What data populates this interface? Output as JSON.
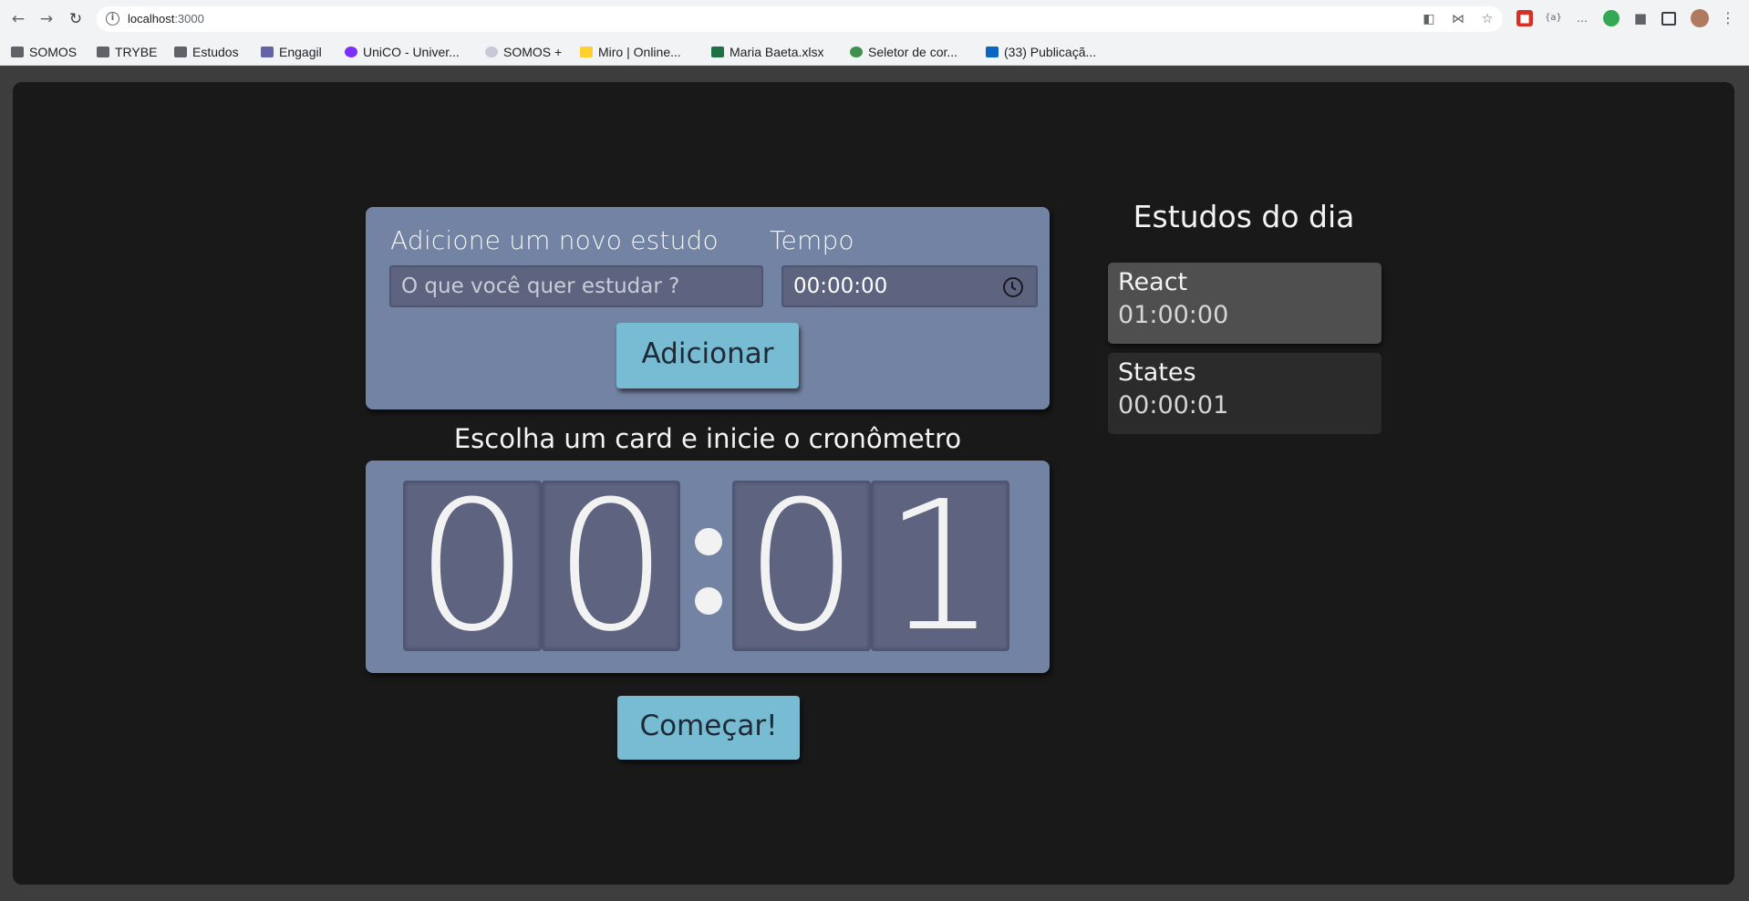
{
  "browser": {
    "url_host": "localhost",
    "url_port": ":3000",
    "bookmarks": [
      {
        "label": "SOMOS",
        "icon": "folder-icon"
      },
      {
        "label": "TRYBE",
        "icon": "folder-icon"
      },
      {
        "label": "Estudos",
        "icon": "folder-icon"
      },
      {
        "label": "Engagil",
        "icon": "teams-icon"
      },
      {
        "label": "UniCO - Univer...",
        "icon": "unico-icon"
      },
      {
        "label": "SOMOS +",
        "icon": "somos-plus-icon"
      },
      {
        "label": "Miro | Online...",
        "icon": "miro-icon"
      },
      {
        "label": "Maria Baeta.xlsx",
        "icon": "excel-icon"
      },
      {
        "label": "Seletor de cor...",
        "icon": "color-picker-icon"
      },
      {
        "label": "(33) Publicaçã...",
        "icon": "linkedin-icon"
      }
    ]
  },
  "form": {
    "study_label": "Adicione um novo estudo",
    "time_label": "Tempo",
    "study_placeholder": "O que você quer estudar ?",
    "time_value": "00:00:00",
    "add_button": "Adicionar"
  },
  "timer": {
    "title": "Escolha um card e inicie o cronômetro",
    "digits": [
      "0",
      "0",
      "0",
      "1"
    ],
    "start_button": "Começar!"
  },
  "sidebar": {
    "title": "Estudos do dia",
    "items": [
      {
        "name": "React",
        "time": "01:00:00",
        "selected": true
      },
      {
        "name": "States",
        "time": "00:00:01",
        "selected": false
      }
    ]
  },
  "colors": {
    "card": "#7383a3",
    "button": "#78bcd4",
    "background": "#191919"
  }
}
